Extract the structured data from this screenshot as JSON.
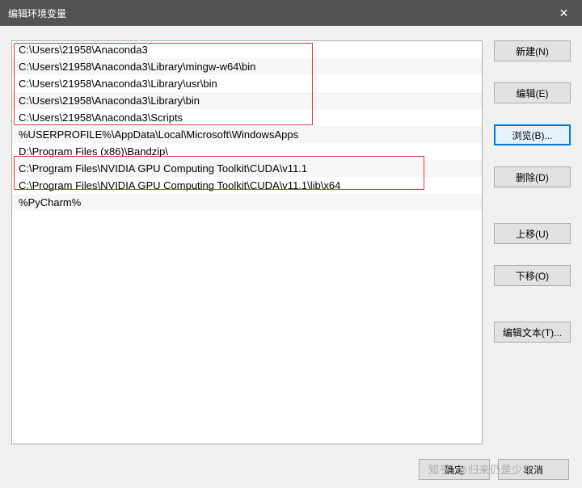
{
  "titlebar": {
    "title": "编辑环境变量",
    "close_glyph": "✕"
  },
  "paths": [
    "C:\\Users\\21958\\Anaconda3",
    "C:\\Users\\21958\\Anaconda3\\Library\\mingw-w64\\bin",
    "C:\\Users\\21958\\Anaconda3\\Library\\usr\\bin",
    "C:\\Users\\21958\\Anaconda3\\Library\\bin",
    "C:\\Users\\21958\\Anaconda3\\Scripts",
    "%USERPROFILE%\\AppData\\Local\\Microsoft\\WindowsApps",
    "D:\\Program Files (x86)\\Bandzip\\",
    "C:\\Program Files\\NVIDIA GPU Computing Toolkit\\CUDA\\v11.1",
    "C:\\Program Files\\NVIDIA GPU Computing Toolkit\\CUDA\\v11.1\\lib\\x64",
    "%PyCharm%"
  ],
  "buttons": {
    "new": "新建(N)",
    "edit": "编辑(E)",
    "browse": "浏览(B)...",
    "delete": "删除(D)",
    "move_up": "上移(U)",
    "move_down": "下移(O)",
    "edit_text": "编辑文本(T)...",
    "ok": "确定",
    "cancel": "取消"
  },
  "watermark": {
    "logo": "知乎",
    "text": "@归来仍是少年"
  }
}
